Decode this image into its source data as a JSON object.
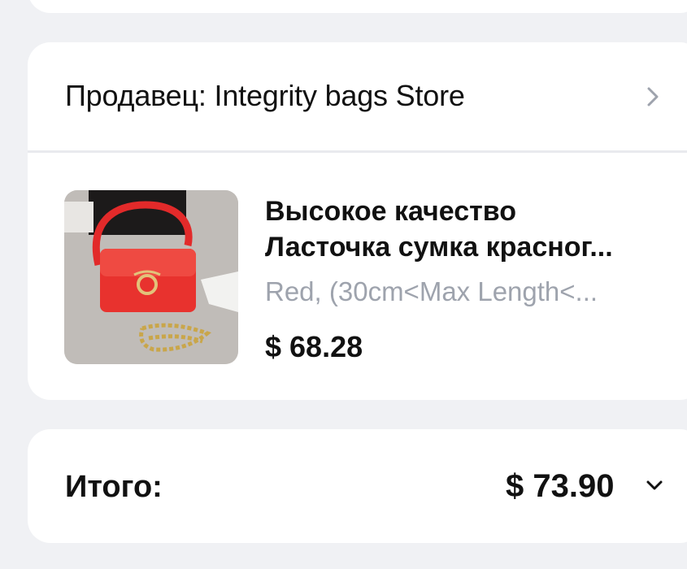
{
  "seller": {
    "label": "Продавец: Integrity bags Store",
    "icon": "chevron-right-icon"
  },
  "product": {
    "image": "red-handbag-photo",
    "title_line1": "Высокое качество",
    "title_line2": "Ласточка сумка красног...",
    "variant": "Red, (30cm<Max Length<...",
    "price": "$ 68.28"
  },
  "total": {
    "label": "Итого:",
    "value": "$ 73.90",
    "icon": "chevron-down-icon"
  },
  "colors": {
    "background": "#f0f1f4",
    "card": "#ffffff",
    "muted_text": "#9ea3ad",
    "bag_red": "#e8322e"
  }
}
